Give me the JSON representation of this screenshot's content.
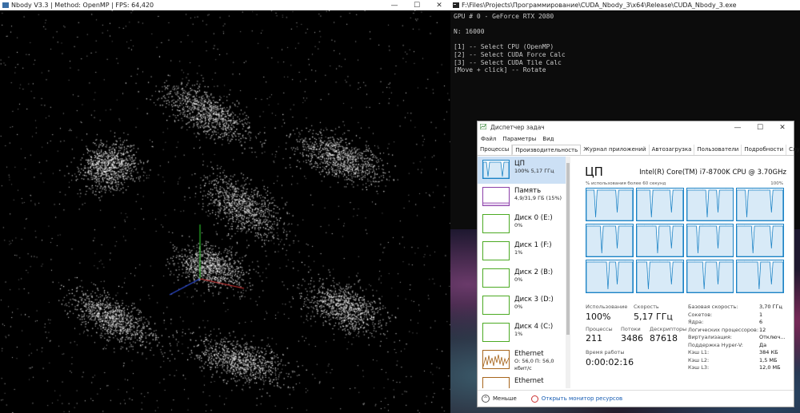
{
  "nbody": {
    "title": "Nbody V3.3 | Method: OpenMP | FPS: 64,420",
    "controls": {
      "minimize": "—",
      "maximize": "☐",
      "close": "✕"
    }
  },
  "console": {
    "title": "F:\\Files\\Projects\\Программирование\\CUDA_Nbody_3\\x64\\Release\\CUDA_Nbody_3.exe",
    "lines": [
      "GPU # 0 - GeForce RTX 2080",
      "",
      "N: 16000",
      "",
      "[1] -- Select CPU (OpenMP)",
      "[2] -- Select CUDA Force Calc",
      "[3] -- Select CUDA Tile Calc",
      "[Move + click] -- Rotate"
    ]
  },
  "taskmanager": {
    "title": "Диспетчер задач",
    "menu": [
      "Файл",
      "Параметры",
      "Вид"
    ],
    "tabs": [
      "Процессы",
      "Производительность",
      "Журнал приложений",
      "Автозагрузка",
      "Пользователи",
      "Подробности",
      "Службы"
    ],
    "active_tab": 1,
    "sidebar": [
      {
        "name": "ЦП",
        "sub": "100% 5,17 ГГц",
        "kind": "cpu"
      },
      {
        "name": "Память",
        "sub": "4,9/31,9 ГБ (15%)",
        "kind": "mem"
      },
      {
        "name": "Диск 0 (E:)",
        "sub": "0%",
        "kind": "disk"
      },
      {
        "name": "Диск 1 (F:)",
        "sub": "1%",
        "kind": "disk"
      },
      {
        "name": "Диск 2 (B:)",
        "sub": "0%",
        "kind": "disk"
      },
      {
        "name": "Диск 3 (D:)",
        "sub": "0%",
        "kind": "disk"
      },
      {
        "name": "Диск 4 (C:)",
        "sub": "1%",
        "kind": "disk"
      },
      {
        "name": "Ethernet",
        "sub": "О: 56,0 П: 56,0 кбит/с",
        "kind": "eth"
      },
      {
        "name": "Ethernet",
        "sub": "",
        "kind": "eth"
      }
    ],
    "cpu": {
      "title": "ЦП",
      "name": "Intel(R) Core(TM) i7-8700K CPU @ 3.70GHz",
      "graph_caption": "% использования более 60 секунд",
      "graph_max": "100%",
      "usage_label": "Использование",
      "usage_value": "100%",
      "speed_label": "Скорость",
      "speed_value": "5,17 ГГц",
      "processes_label": "Процессы",
      "processes_value": "211",
      "threads_label": "Потоки",
      "threads_value": "3486",
      "handles_label": "Дескрипторы",
      "handles_value": "87618",
      "uptime_label": "Время работы",
      "uptime_value": "0:00:02:16",
      "specs": [
        {
          "label": "Базовая скорость:",
          "value": "3,70 ГГц"
        },
        {
          "label": "Сокетов:",
          "value": "1"
        },
        {
          "label": "Ядра:",
          "value": "6"
        },
        {
          "label": "Логических процессоров:",
          "value": "12"
        },
        {
          "label": "Виртуализация:",
          "value": "Отключ..."
        },
        {
          "label": "Поддержка Hyper-V:",
          "value": "Да"
        },
        {
          "label": "Кэш L1:",
          "value": "384 КБ"
        },
        {
          "label": "Кэш L2:",
          "value": "1,5 МБ"
        },
        {
          "label": "Кэш L3:",
          "value": "12,0 МБ"
        }
      ]
    },
    "footer": {
      "less": "Меньше",
      "resmon": "Открыть монитор ресурсов"
    },
    "controls": {
      "minimize": "—",
      "maximize": "☐",
      "close": "✕"
    }
  },
  "colors": {
    "cpu_blue": "#1b83c6",
    "memory_purple": "#8b3fa8",
    "disk_green": "#4caa23",
    "ethernet_orange": "#a7651c"
  }
}
